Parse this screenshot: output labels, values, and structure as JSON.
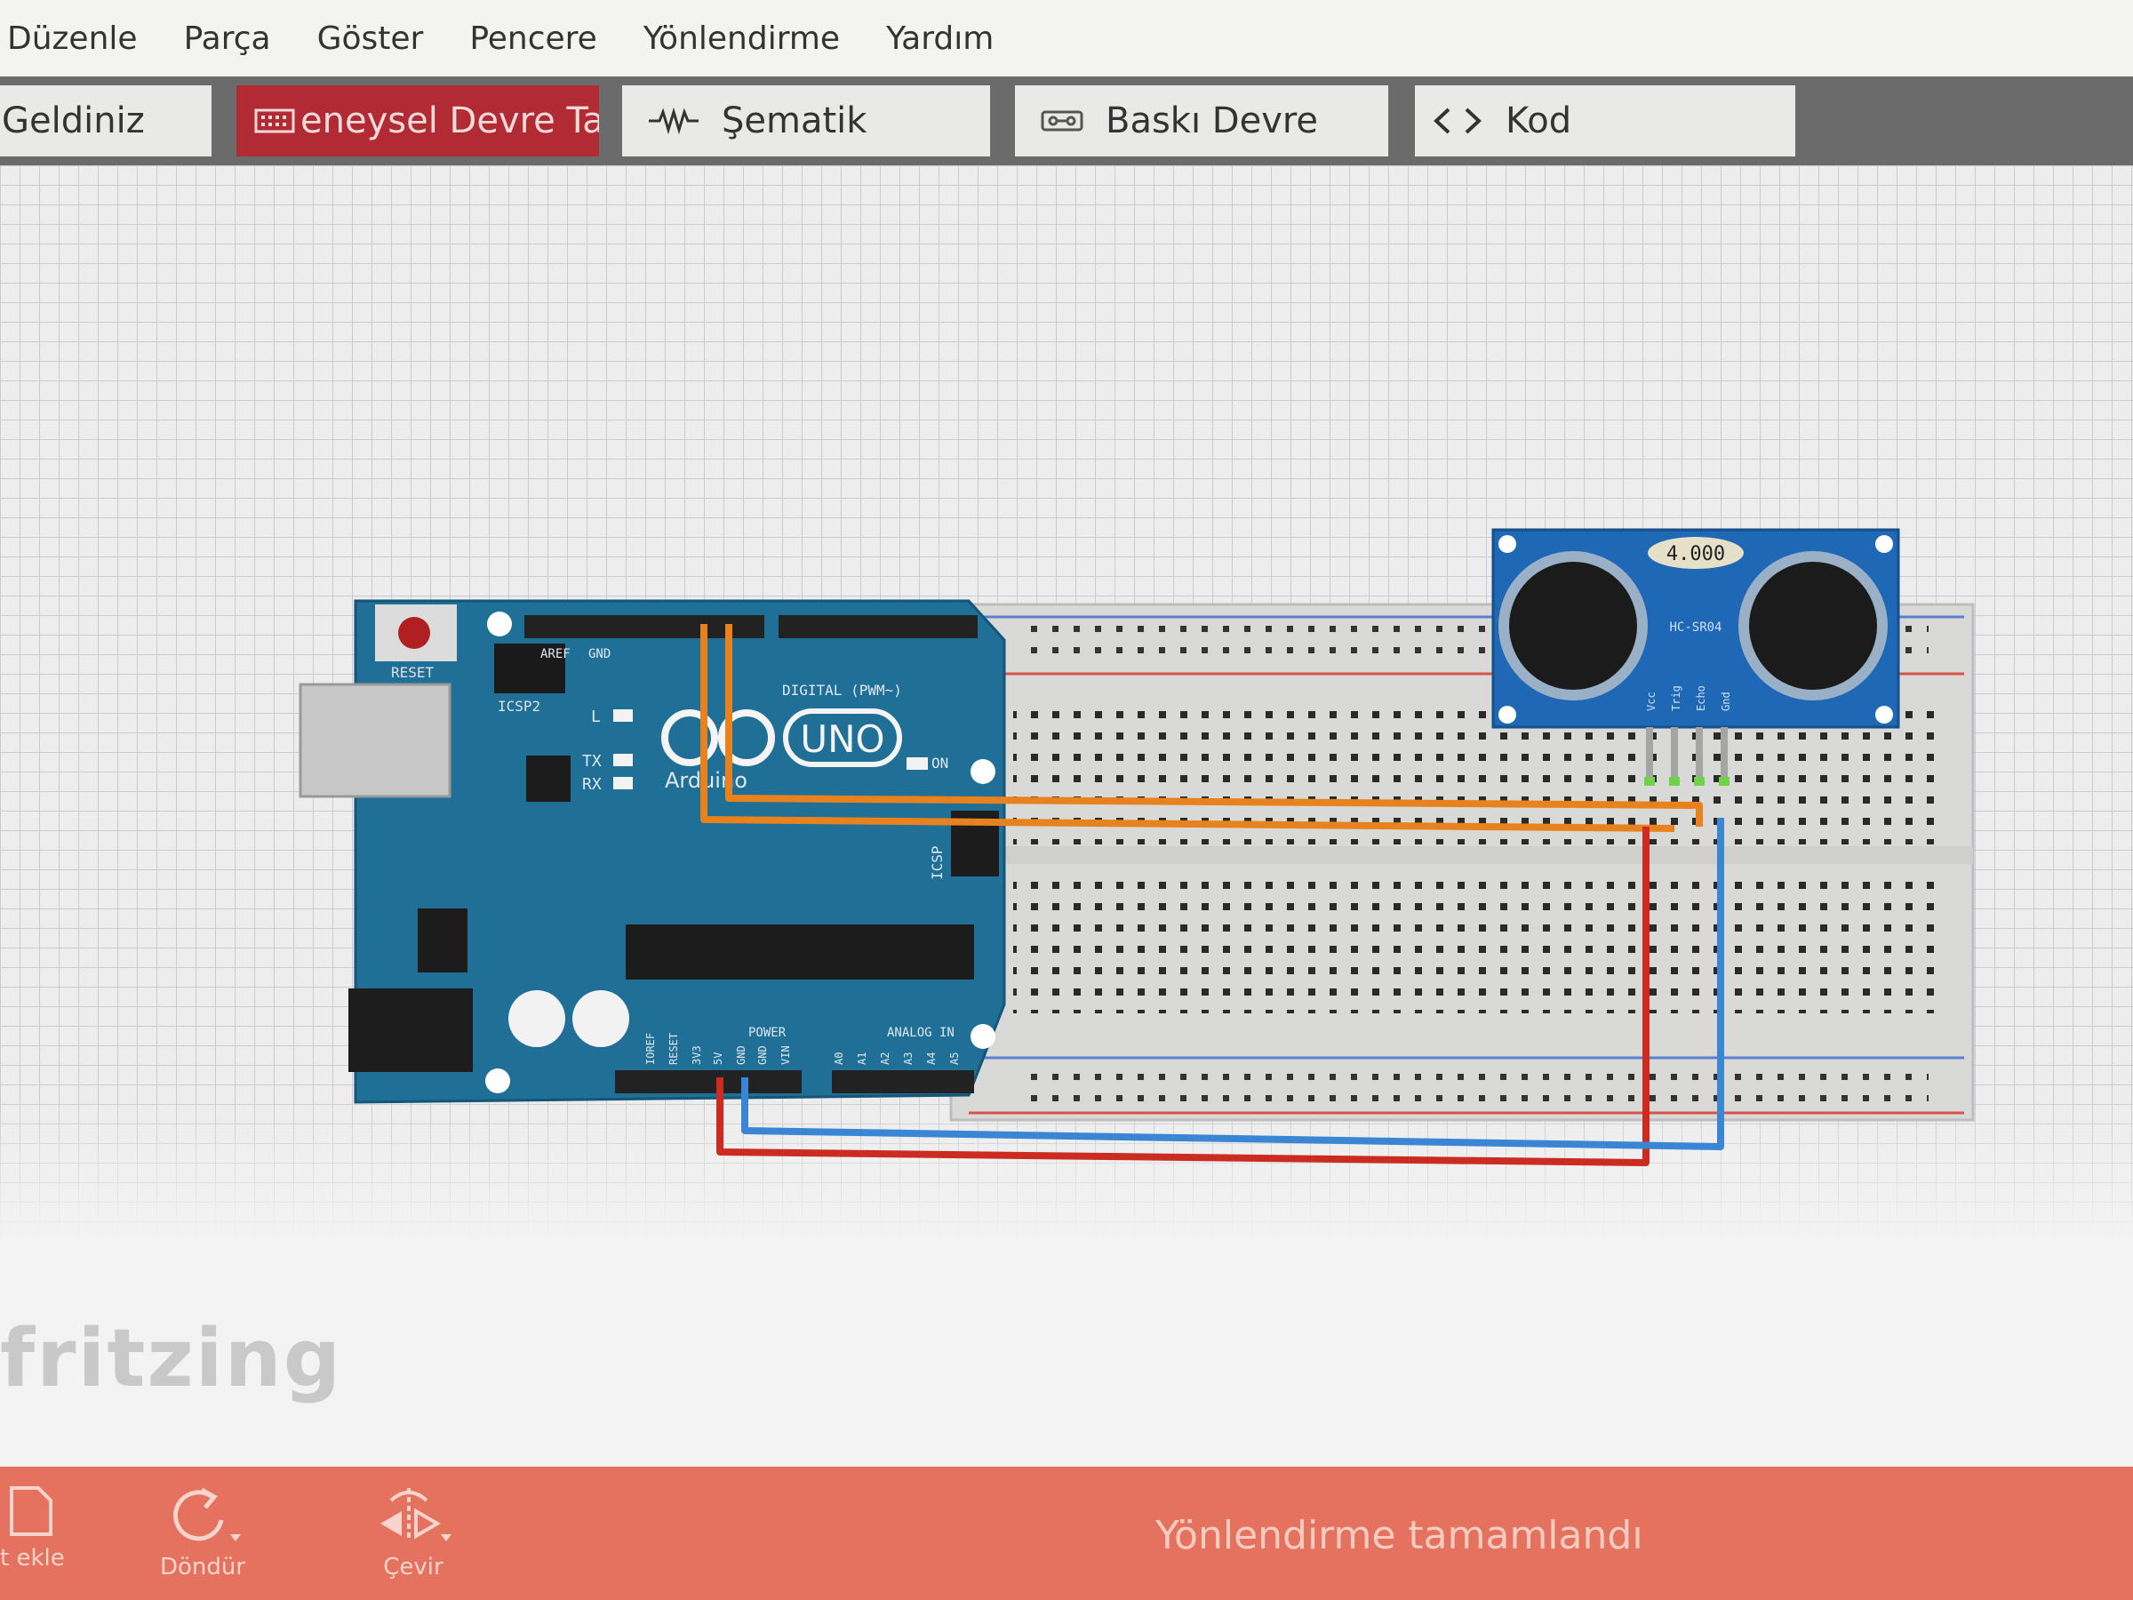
{
  "menu": [
    "Düzenle",
    "Parça",
    "Göster",
    "Pencere",
    "Yönlendirme",
    "Yardım"
  ],
  "tabs": [
    {
      "label": "Geldiniz",
      "icon": "none"
    },
    {
      "label": "eneysel Devre Tahta",
      "icon": "breadboard-icon",
      "active": true
    },
    {
      "label": "Şematik",
      "icon": "schematic-icon"
    },
    {
      "label": "Baskı Devre",
      "icon": "pcb-icon"
    },
    {
      "label": "Kod",
      "icon": "code-icon"
    }
  ],
  "arduino": {
    "reset_label": "RESET",
    "icsp2_label": "ICSP2",
    "digital_label": "DIGITAL (PWM~)",
    "aref_label": "AREF",
    "gnd_label": "GND",
    "l_label": "L",
    "tx_label": "TX",
    "rx_label": "RX",
    "on_label": "ON",
    "uno_label": "UNO",
    "brand_label": "Arduino",
    "icsp_label": "ICSP",
    "power_label": "POWER",
    "analog_label": "ANALOG IN",
    "power_pins": [
      "IOREF",
      "RESET",
      "3V3",
      "5V",
      "GND",
      "GND",
      "VIN"
    ],
    "analog_pins": [
      "A0",
      "A1",
      "A2",
      "A3",
      "A4",
      "A5"
    ]
  },
  "sensor": {
    "crystal_label": "4.000",
    "model_label": "HC-SR04",
    "pins": [
      "Vcc",
      "Trig",
      "Echo",
      "Gnd"
    ]
  },
  "watermark": "fritzing",
  "colors": {
    "board": "#1f6f96",
    "sensor": "#1f68b5",
    "wire_orange": "#e8821e",
    "wire_red": "#cc2b22",
    "wire_blue": "#3a86d4",
    "active_tab": "#b22a33",
    "toolbar": "#e4725e"
  },
  "toolbar": {
    "add_label": "t ekle",
    "rotate_label": "Döndür",
    "flip_label": "Çevir",
    "status": "Yönlendirme tamamlandı"
  }
}
